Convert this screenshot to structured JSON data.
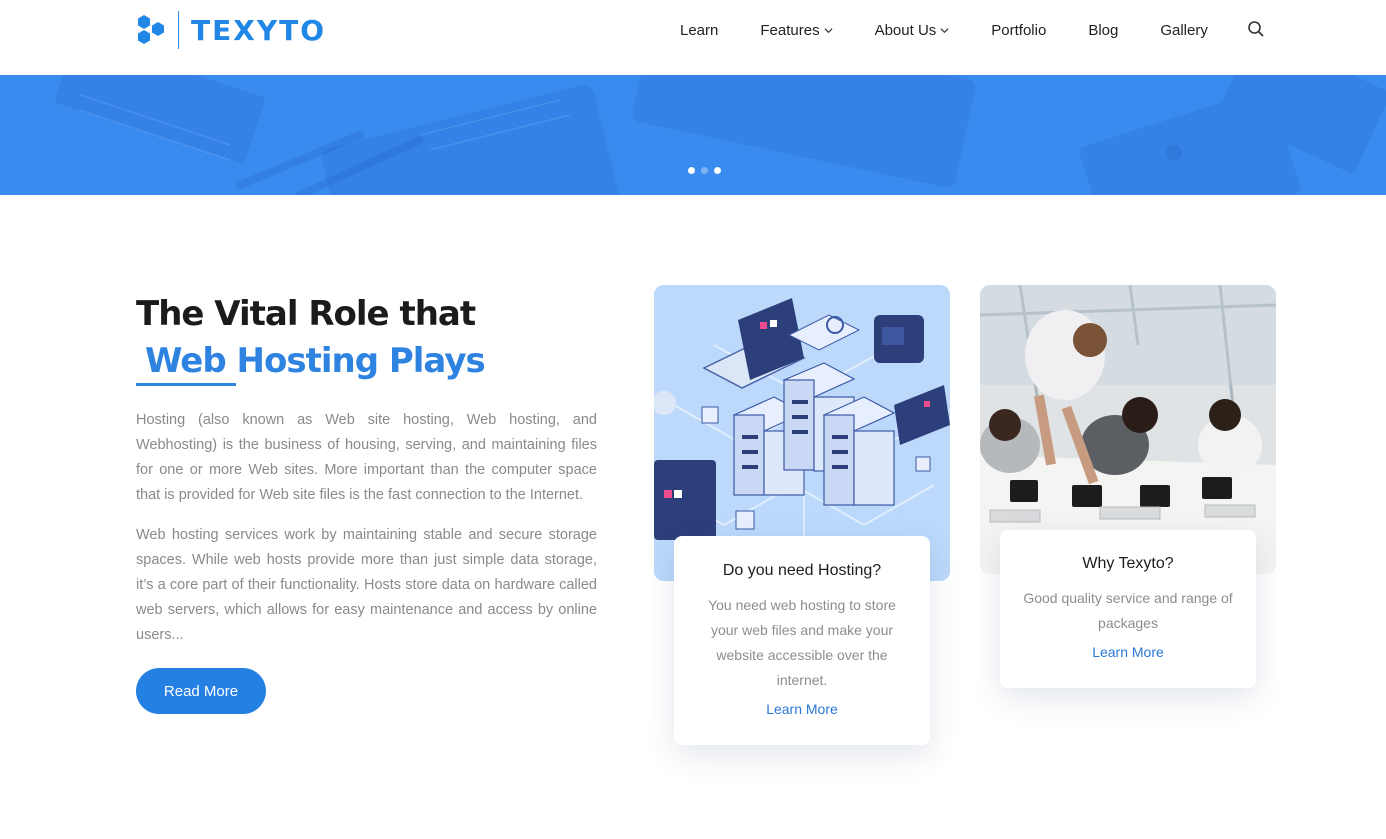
{
  "brand": {
    "name": "TEXYTO"
  },
  "nav": {
    "items": [
      {
        "label": "Learn"
      },
      {
        "label": "Features"
      },
      {
        "label": "About Us"
      },
      {
        "label": "Portfolio"
      },
      {
        "label": "Blog"
      },
      {
        "label": "Gallery"
      }
    ]
  },
  "hero": {
    "slides": 3,
    "active_slide": 2
  },
  "intro": {
    "title_line1": "The Vital Role that",
    "title_line2": "Web Hosting Plays",
    "paragraph1": "Hosting (also known as Web site hosting, Web hosting, and Webhosting) is the business of housing, serving, and maintaining files for one or more Web sites. More important than the computer space that is provided for Web site files is the fast connection to the Internet.",
    "paragraph2": "Web hosting services work by maintaining stable and secure storage spaces. While web hosts provide more than just simple data storage, it’s a core part of their functionality. Hosts store data on hardware called web servers, which allows for easy maintenance and access by online users...",
    "button": "Read More"
  },
  "cards": [
    {
      "title": "Do you need Hosting?",
      "text": "You need web hosting to store your web files and make your website accessible over the internet.",
      "link": "Learn More"
    },
    {
      "title": "Why Texyto?",
      "text": "Good quality service and range of packages",
      "link": "Learn More"
    }
  ],
  "colors": {
    "accent": "#2580e4",
    "hero": "#3a8bf0"
  }
}
